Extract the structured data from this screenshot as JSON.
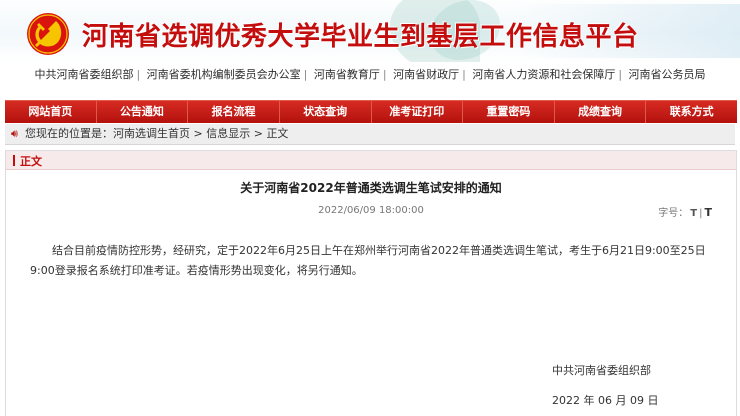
{
  "header": {
    "site_title": "河南省选调优秀大学毕业生到基层工作信息平台",
    "brand_color": "#c40d0d"
  },
  "units": [
    "中共河南省委组织部",
    "河南省委机构编制委员会办公室",
    "河南省教育厅",
    "河南省财政厅",
    "河南省人力资源和社会保障厅",
    "河南省公务员局"
  ],
  "nav": {
    "items": [
      "网站首页",
      "公告通知",
      "报名流程",
      "状态查询",
      "准考证打印",
      "重置密码",
      "成绩查询",
      "联系方式"
    ]
  },
  "breadcrumb": {
    "prefix": "您现在的位置是：",
    "items": [
      "河南选调生首页",
      "信息显示",
      "正文"
    ],
    "separator": ">"
  },
  "article": {
    "section_label": "正文",
    "title": "关于河南省2022年普通类选调生笔试安排的通知",
    "datetime": "2022/06/09 18:00:00",
    "font_size_label": "字号：",
    "font_small": "T",
    "font_sep": "|",
    "font_large": "T",
    "body": "结合目前疫情防控形势，经研究，定于2022年6月25日上午在郑州举行河南省2022年普通类选调生笔试，考生于6月21日9:00至25日9:00登录报名系统打印准考证。若疫情形势出现变化，将另行通知。",
    "sign_org": "中共河南省委组织部",
    "sign_date": "2022 年 06 月 09 日"
  }
}
